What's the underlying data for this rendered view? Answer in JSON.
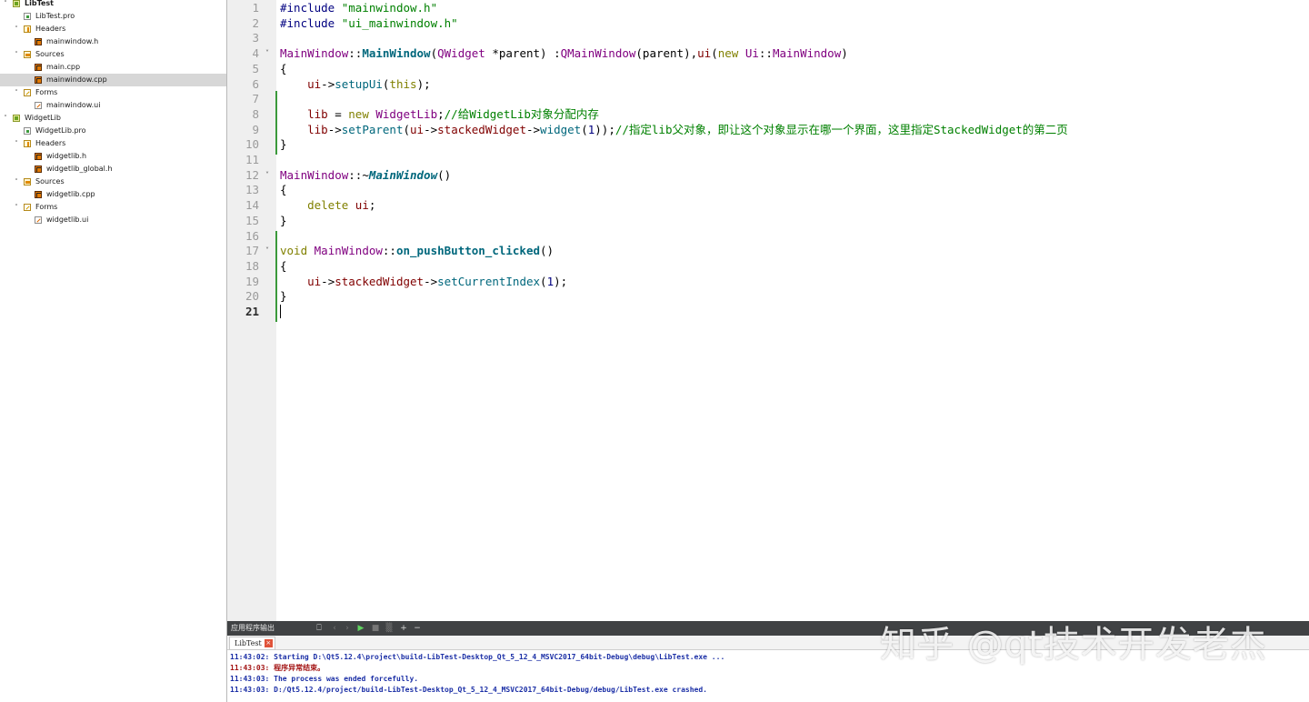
{
  "tree": [
    {
      "label": "LibTest",
      "depth": 0,
      "arrow": "˅",
      "icon": "project",
      "bold": true,
      "sel": false
    },
    {
      "label": "LibTest.pro",
      "depth": 1,
      "arrow": "",
      "icon": "pro",
      "bold": false,
      "sel": false
    },
    {
      "label": "Headers",
      "depth": 1,
      "arrow": "˅",
      "icon": "folder-h",
      "bold": false,
      "sel": false
    },
    {
      "label": "mainwindow.h",
      "depth": 2,
      "arrow": "",
      "icon": "src",
      "bold": false,
      "sel": false
    },
    {
      "label": "Sources",
      "depth": 1,
      "arrow": "˅",
      "icon": "folder-s",
      "bold": false,
      "sel": false
    },
    {
      "label": "main.cpp",
      "depth": 2,
      "arrow": "",
      "icon": "src",
      "bold": false,
      "sel": false
    },
    {
      "label": "mainwindow.cpp",
      "depth": 2,
      "arrow": "",
      "icon": "src",
      "bold": false,
      "sel": true
    },
    {
      "label": "Forms",
      "depth": 1,
      "arrow": "˅",
      "icon": "folder-f",
      "bold": false,
      "sel": false
    },
    {
      "label": "mainwindow.ui",
      "depth": 2,
      "arrow": "",
      "icon": "ui",
      "bold": false,
      "sel": false
    },
    {
      "label": "WidgetLib",
      "depth": 0,
      "arrow": "˅",
      "icon": "project",
      "bold": false,
      "sel": false
    },
    {
      "label": "WidgetLib.pro",
      "depth": 1,
      "arrow": "",
      "icon": "pro",
      "bold": false,
      "sel": false
    },
    {
      "label": "Headers",
      "depth": 1,
      "arrow": "˅",
      "icon": "folder-h",
      "bold": false,
      "sel": false
    },
    {
      "label": "widgetlib.h",
      "depth": 2,
      "arrow": "",
      "icon": "src",
      "bold": false,
      "sel": false
    },
    {
      "label": "widgetlib_global.h",
      "depth": 2,
      "arrow": "",
      "icon": "src",
      "bold": false,
      "sel": false
    },
    {
      "label": "Sources",
      "depth": 1,
      "arrow": "˅",
      "icon": "folder-s",
      "bold": false,
      "sel": false
    },
    {
      "label": "widgetlib.cpp",
      "depth": 2,
      "arrow": "",
      "icon": "src",
      "bold": false,
      "sel": false
    },
    {
      "label": "Forms",
      "depth": 1,
      "arrow": "˅",
      "icon": "folder-f",
      "bold": false,
      "sel": false
    },
    {
      "label": "widgetlib.ui",
      "depth": 2,
      "arrow": "",
      "icon": "ui",
      "bold": false,
      "sel": false
    }
  ],
  "editor": {
    "current_line": 21,
    "fold_lines": [
      4,
      12,
      17
    ],
    "lines": [
      [
        [
          "pp",
          "#include "
        ],
        [
          "str",
          "\"mainwindow.h\""
        ]
      ],
      [
        [
          "pp",
          "#include "
        ],
        [
          "str",
          "\"ui_mainwindow.h\""
        ]
      ],
      [],
      [
        [
          "type",
          "MainWindow"
        ],
        [
          "",
          "::"
        ],
        [
          "fnb",
          "MainWindow"
        ],
        [
          "",
          "("
        ],
        [
          "type",
          "QWidget"
        ],
        [
          "",
          " *"
        ],
        [
          "",
          "parent"
        ],
        [
          "",
          ") :"
        ],
        [
          "type",
          "QMainWindow"
        ],
        [
          "",
          "(parent),"
        ],
        [
          "mem",
          "ui"
        ],
        [
          "",
          "("
        ],
        [
          "kw",
          "new"
        ],
        [
          "",
          " "
        ],
        [
          "type",
          "Ui"
        ],
        [
          "",
          "::"
        ],
        [
          "type",
          "MainWindow"
        ],
        [
          "",
          ")"
        ]
      ],
      [
        [
          "",
          "{"
        ]
      ],
      [
        [
          "",
          "    "
        ],
        [
          "mem",
          "ui"
        ],
        [
          "",
          "->"
        ],
        [
          "fn",
          "setupUi"
        ],
        [
          "",
          "("
        ],
        [
          "kw",
          "this"
        ],
        [
          "",
          ");"
        ]
      ],
      [],
      [
        [
          "",
          "    "
        ],
        [
          "mem",
          "lib"
        ],
        [
          "",
          " = "
        ],
        [
          "kw",
          "new"
        ],
        [
          "",
          " "
        ],
        [
          "type",
          "WidgetLib"
        ],
        [
          "",
          ";"
        ],
        [
          "com",
          "//给WidgetLib对象分配内存"
        ]
      ],
      [
        [
          "",
          "    "
        ],
        [
          "mem",
          "lib"
        ],
        [
          "",
          "->"
        ],
        [
          "fn",
          "setParent"
        ],
        [
          "",
          "("
        ],
        [
          "mem",
          "ui"
        ],
        [
          "",
          "->"
        ],
        [
          "mem",
          "stackedWidget"
        ],
        [
          "",
          "->"
        ],
        [
          "fn",
          "widget"
        ],
        [
          "",
          "("
        ],
        [
          "num",
          "1"
        ],
        [
          "",
          "));"
        ],
        [
          "com",
          "//指定lib父对象，即让这个对象显示在哪一个界面，这里指定StackedWidget的第二页"
        ]
      ],
      [
        [
          "",
          "}"
        ]
      ],
      [],
      [
        [
          "type",
          "MainWindow"
        ],
        [
          "",
          "::~"
        ],
        [
          "fni",
          "MainWindow"
        ],
        [
          "",
          "()"
        ]
      ],
      [
        [
          "",
          "{"
        ]
      ],
      [
        [
          "",
          "    "
        ],
        [
          "kw",
          "delete"
        ],
        [
          "",
          " "
        ],
        [
          "mem",
          "ui"
        ],
        [
          "",
          ";"
        ]
      ],
      [
        [
          "",
          "}"
        ]
      ],
      [],
      [
        [
          "kw",
          "void"
        ],
        [
          "",
          " "
        ],
        [
          "type",
          "MainWindow"
        ],
        [
          "",
          "::"
        ],
        [
          "fnb",
          "on_pushButton_clicked"
        ],
        [
          "",
          "()"
        ]
      ],
      [
        [
          "",
          "{"
        ]
      ],
      [
        [
          "",
          "    "
        ],
        [
          "mem",
          "ui"
        ],
        [
          "",
          "->"
        ],
        [
          "mem",
          "stackedWidget"
        ],
        [
          "",
          "->"
        ],
        [
          "fn",
          "setCurrentIndex"
        ],
        [
          "",
          "("
        ],
        [
          "num",
          "1"
        ],
        [
          "",
          ");"
        ]
      ],
      [
        [
          "",
          "}"
        ]
      ],
      []
    ]
  },
  "output": {
    "pane_title": "应用程序输出",
    "tab_label": "LibTest",
    "close_glyph": "×",
    "buttons": [
      "⎕",
      "‹",
      "›",
      "▶",
      "■",
      "▒",
      "+",
      "−"
    ],
    "log": [
      {
        "text": "11:43:02: Starting D:\\Qt5.12.4\\project\\build-LibTest-Desktop_Qt_5_12_4_MSVC2017_64bit-Debug\\debug\\LibTest.exe ...",
        "color": "blue"
      },
      {
        "text": "11:43:03: 程序异常结束。",
        "color": "red"
      },
      {
        "text": "11:43:03: The process was ended forcefully.",
        "color": "blue"
      },
      {
        "text": "11:43:03: D:/Qt5.12.4/project/build-LibTest-Desktop_Qt_5_12_4_MSVC2017_64bit-Debug/debug/LibTest.exe crashed.",
        "color": "blue"
      }
    ]
  },
  "watermark": "知乎 @qt技术开发老杰",
  "colors": {
    "keyword": "#808000",
    "type": "#800080",
    "function": "#00677c",
    "string": "#008000",
    "comment": "#008000",
    "member": "#800000",
    "preprocessor": "#000080",
    "changed_bar": "#3b9a3b",
    "output_bar": "#404244"
  }
}
